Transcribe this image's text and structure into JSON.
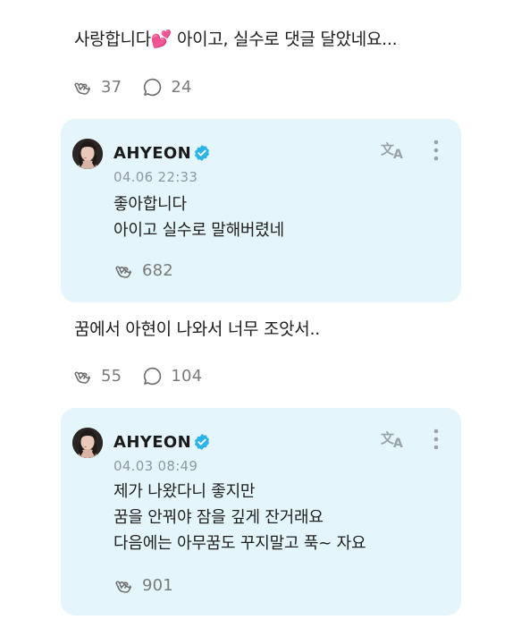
{
  "posts": [
    {
      "text_main": "사랑합니다",
      "emoji": "💕",
      "text_rest": " 아이고, 실수로 댓글 달았네요...",
      "likes": "37",
      "comments": "24",
      "reply": {
        "artist": "AHYEON",
        "timestamp": "04.06 22:33",
        "lines": [
          "좋아합니다",
          "아이고 실수로 말해버렸네"
        ],
        "likes": "682"
      }
    },
    {
      "text": "꿈에서 아현이 나와서 너무 조앗서..",
      "likes": "55",
      "comments": "104",
      "reply": {
        "artist": "AHYEON",
        "timestamp": "04.03 08:49",
        "lines": [
          "제가 나왔다니 좋지만",
          "꿈을 안꿔야 잠을 깊게 잔거래요",
          "다음에는 아무꿈도 꾸지말고 푹~ 자요"
        ],
        "likes": "901"
      }
    }
  ],
  "icons": {
    "like": "heart-hands-icon",
    "comment": "comment-bubble-icon",
    "translate": "translate-icon",
    "more": "more-vertical-icon",
    "verified": "verified-badge-icon"
  },
  "colors": {
    "card_bg": "#e4f6fc",
    "verified": "#2ab4e8",
    "muted": "#7a7a7a"
  }
}
